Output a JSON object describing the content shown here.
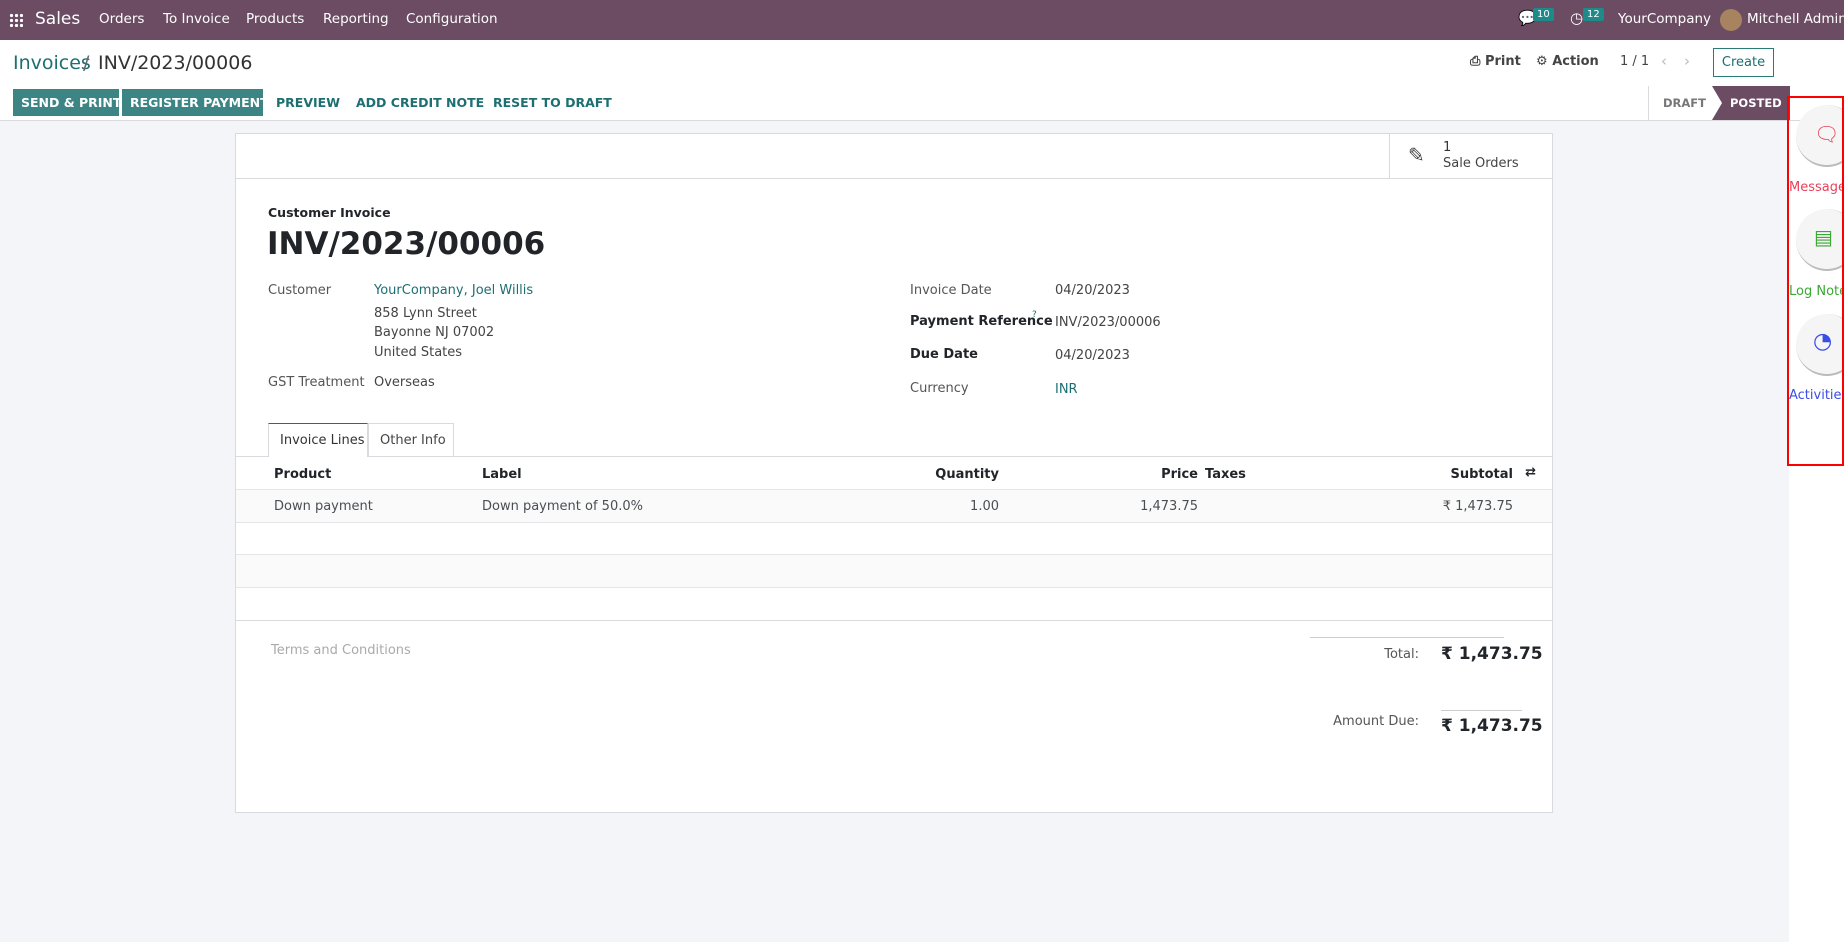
{
  "topbar": {
    "app": "Sales",
    "menu": [
      "Orders",
      "To Invoice",
      "Products",
      "Reporting",
      "Configuration"
    ],
    "messages_count": "10",
    "activities_count": "12",
    "company": "YourCompany",
    "user": "Mitchell Admin"
  },
  "breadcrumb": {
    "parent": "Invoices",
    "separator": "/",
    "current": "INV/2023/00006"
  },
  "controls": {
    "print": "Print",
    "action": "Action",
    "pager": "1 / 1",
    "create": "Create"
  },
  "buttons": {
    "send_print": "SEND & PRINT",
    "register_payment": "REGISTER PAYMENT",
    "preview": "PREVIEW",
    "add_credit_note": "ADD CREDIT NOTE",
    "reset_to_draft": "RESET TO DRAFT"
  },
  "status": {
    "steps": [
      "DRAFT",
      "POSTED"
    ],
    "active": "POSTED"
  },
  "smart_button": {
    "count": "1",
    "label": "Sale Orders"
  },
  "invoice": {
    "type": "Customer Invoice",
    "number": "INV/2023/00006",
    "customer_label": "Customer",
    "customer": "YourCompany, Joel Willis",
    "address": [
      "858 Lynn Street",
      "Bayonne NJ 07002",
      "United States"
    ],
    "gst_label": "GST Treatment",
    "gst": "Overseas",
    "invoice_date_label": "Invoice Date",
    "invoice_date": "04/20/2023",
    "payment_ref_label": "Payment Reference",
    "payment_ref_help": "?",
    "payment_ref": "INV/2023/00006",
    "due_date_label": "Due Date",
    "due_date": "04/20/2023",
    "currency_label": "Currency",
    "currency": "INR"
  },
  "tabs": [
    "Invoice Lines",
    "Other Info"
  ],
  "table": {
    "headers": {
      "product": "Product",
      "label": "Label",
      "quantity": "Quantity",
      "price": "Price",
      "taxes": "Taxes",
      "subtotal": "Subtotal"
    },
    "rows": [
      {
        "product": "Down payment",
        "label": "Down payment of 50.0%",
        "quantity": "1.00",
        "price": "1,473.75",
        "taxes": "",
        "subtotal": "₹ 1,473.75"
      }
    ]
  },
  "footer": {
    "terms_placeholder": "Terms and Conditions",
    "total_label": "Total:",
    "total": "₹ 1,473.75",
    "amount_due_label": "Amount Due:",
    "amount_due": "₹ 1,473.75"
  },
  "side_panel": {
    "message": "Message",
    "log_note": "Log Note",
    "activities": "Activities"
  },
  "colors": {
    "topbar": "#6b4c63",
    "primary": "#3d8585",
    "message": "#e8425a",
    "log_note": "#3aa832",
    "activities": "#3a4ee8",
    "highlight": "#ff0000"
  }
}
